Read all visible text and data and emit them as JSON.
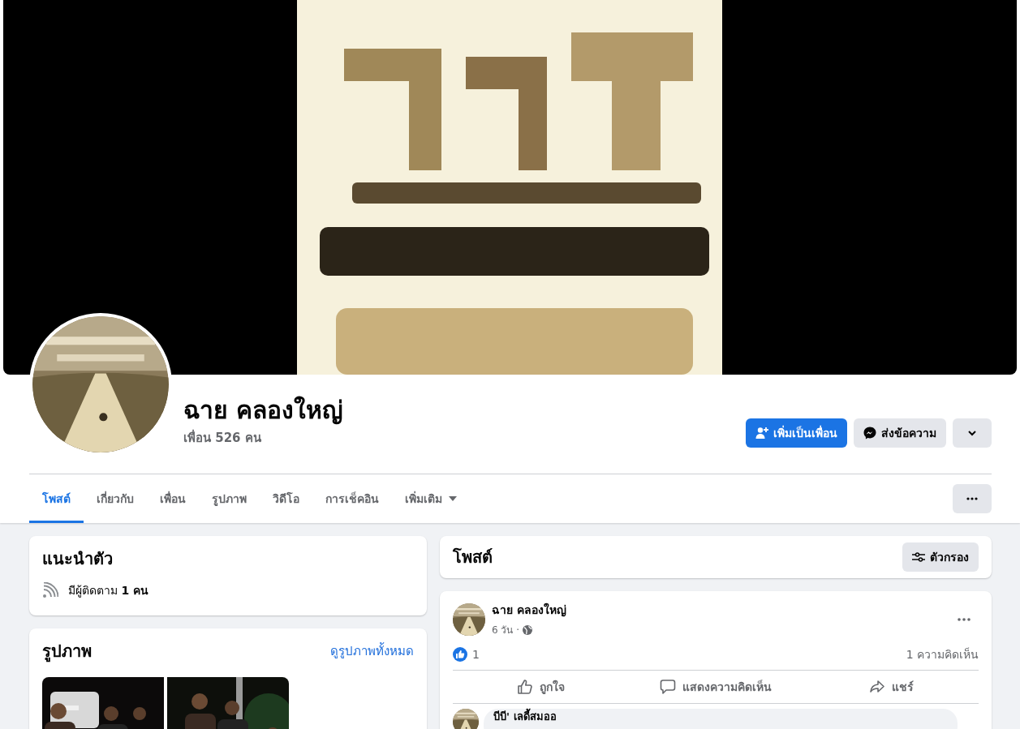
{
  "profile": {
    "name": "ฉาย คลองใหญ่",
    "friends": "เพื่อน 526 คน"
  },
  "actions": [
    {
      "kind": "add-friend",
      "label": "เพิ่มเป็นเพื่อน"
    },
    {
      "kind": "message",
      "label": "ส่งข้อความ"
    },
    {
      "kind": "dropdown"
    }
  ],
  "tabs": [
    {
      "kind": "tab",
      "label": "โพสต์",
      "selected": true
    },
    {
      "kind": "tab",
      "label": "เกี่ยวกับ",
      "selected": false
    },
    {
      "kind": "tab",
      "label": "เพื่อน",
      "selected": false
    },
    {
      "kind": "tab",
      "label": "รูปภาพ",
      "selected": false
    },
    {
      "kind": "tab",
      "label": "วิดีโอ",
      "selected": false
    },
    {
      "kind": "tab",
      "label": "การเช็คอิน",
      "selected": false
    },
    {
      "kind": "menu",
      "label": "เพิ่มเติม",
      "selected": false
    }
  ],
  "intro": {
    "title": "แนะนำตัว",
    "followers": "มีผู้ติดตาม **1 คน**"
  },
  "photos": {
    "title": "รูปภาพ",
    "link": "ดูรูปภาพทั้งหมด"
  },
  "posts_header": {
    "title": "โพสต์",
    "filter": "ตัวกรอง"
  },
  "post": {
    "author": "ฉาย คลองใหญ่",
    "time": "6 วัน ·",
    "likes": "1",
    "comments": "1 ความคิดเห็น",
    "actions": [
      {
        "kind": "like",
        "label": "ถูกใจ"
      },
      {
        "kind": "comment",
        "label": "แสดงความคิดเห็น"
      },
      {
        "kind": "share",
        "label": "แชร์"
      }
    ],
    "comment": {
      "author": "บีบี' เลดี้สมออ"
    }
  }
}
